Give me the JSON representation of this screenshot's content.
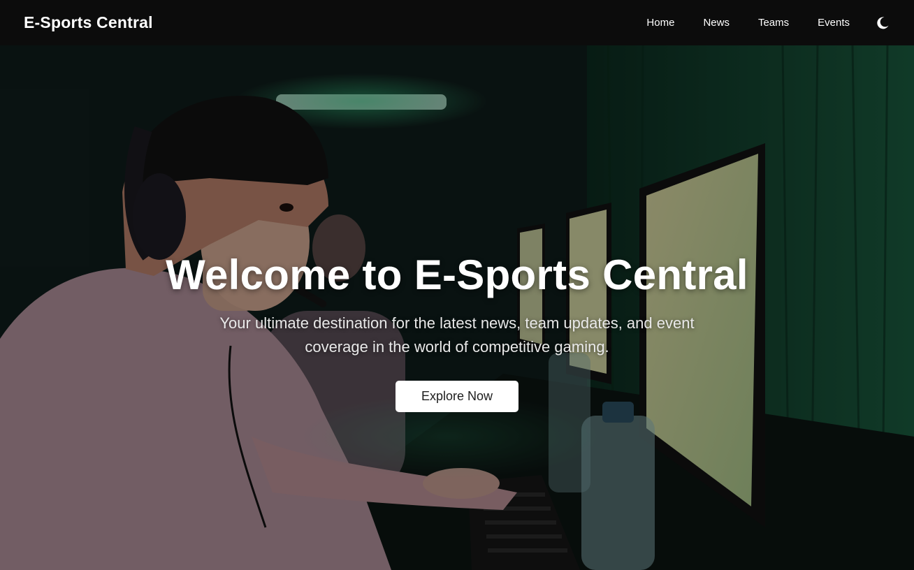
{
  "nav": {
    "brand": "E-Sports Central",
    "links": [
      {
        "label": "Home"
      },
      {
        "label": "News"
      },
      {
        "label": "Teams"
      },
      {
        "label": "Events"
      }
    ],
    "theme_icon": "moon-icon"
  },
  "hero": {
    "title": "Welcome to E-Sports Central",
    "subtitle": "Your ultimate destination for the latest news, team updates, and event coverage in the world of competitive gaming.",
    "cta_label": "Explore Now",
    "background_image": "gaming-arena-photo"
  },
  "colors": {
    "navbar_bg": "#0c0c0c",
    "accent_green": "#2fbf7a",
    "text_primary": "#ffffff",
    "button_bg": "#ffffff",
    "button_text": "#1d1d1d"
  }
}
